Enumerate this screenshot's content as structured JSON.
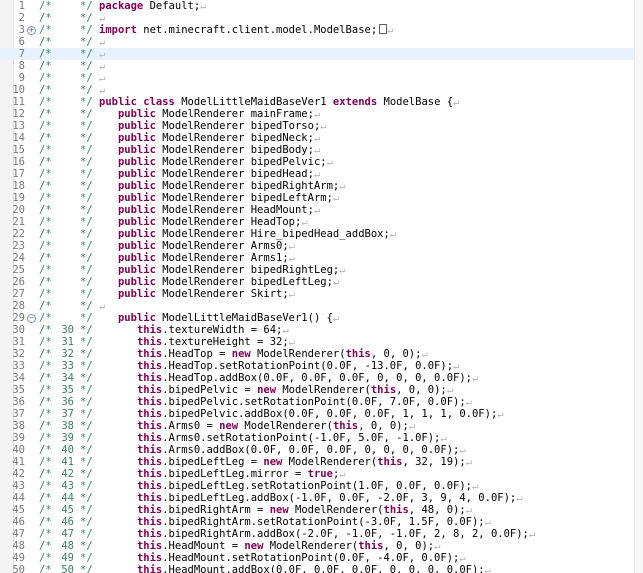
{
  "editor": {
    "comment_marker": "/*",
    "comment_end": "*/",
    "eol_marker": "↵",
    "lines": [
      {
        "n": "1",
        "code": "package Default;"
      },
      {
        "n": "2",
        "code": ""
      },
      {
        "n": "3",
        "code": "import net.minecraft.client.model.ModelBase;",
        "fold": "+",
        "box": true
      },
      {
        "n": "6",
        "code": ""
      },
      {
        "n": "7",
        "code": "",
        "current": true
      },
      {
        "n": "8",
        "code": ""
      },
      {
        "n": "9",
        "code": ""
      },
      {
        "n": "10",
        "code": ""
      },
      {
        "n": "11",
        "code": "public class ModelLittleMaidBaseVer1 extends ModelBase {"
      },
      {
        "n": "12",
        "code": "   public ModelRenderer mainFrame;"
      },
      {
        "n": "13",
        "code": "   public ModelRenderer bipedTorso;"
      },
      {
        "n": "14",
        "code": "   public ModelRenderer bipedNeck;"
      },
      {
        "n": "15",
        "code": "   public ModelRenderer bipedBody;"
      },
      {
        "n": "16",
        "code": "   public ModelRenderer bipedPelvic;"
      },
      {
        "n": "17",
        "code": "   public ModelRenderer bipedHead;"
      },
      {
        "n": "18",
        "code": "   public ModelRenderer bipedRightArm;"
      },
      {
        "n": "19",
        "code": "   public ModelRenderer bipedLeftArm;"
      },
      {
        "n": "20",
        "code": "   public ModelRenderer HeadMount;"
      },
      {
        "n": "21",
        "code": "   public ModelRenderer HeadTop;"
      },
      {
        "n": "22",
        "code": "   public ModelRenderer Hire_bipedHead_addBox;"
      },
      {
        "n": "23",
        "code": "   public ModelRenderer Arms0;"
      },
      {
        "n": "24",
        "code": "   public ModelRenderer Arms1;"
      },
      {
        "n": "25",
        "code": "   public ModelRenderer bipedRightLeg;"
      },
      {
        "n": "26",
        "code": "   public ModelRenderer bipedLeftLeg;"
      },
      {
        "n": "27",
        "code": "   public ModelRenderer Skirt;"
      },
      {
        "n": "28",
        "code": ""
      },
      {
        "n": "29",
        "code": "   public ModelLittleMaidBaseVer1() {",
        "fold": "−"
      },
      {
        "n": "30",
        "orig": "30",
        "code": "      this.textureWidth = 64;"
      },
      {
        "n": "31",
        "orig": "31",
        "code": "      this.textureHeight = 32;"
      },
      {
        "n": "32",
        "orig": "32",
        "code": "      this.HeadTop = new ModelRenderer(this, 0, 0);"
      },
      {
        "n": "33",
        "orig": "33",
        "code": "      this.HeadTop.setRotationPoint(0.0F, -13.0F, 0.0F);"
      },
      {
        "n": "34",
        "orig": "34",
        "code": "      this.HeadTop.addBox(0.0F, 0.0F, 0.0F, 0, 0, 0, 0.0F);"
      },
      {
        "n": "35",
        "orig": "35",
        "code": "      this.bipedPelvic = new ModelRenderer(this, 0, 0);"
      },
      {
        "n": "36",
        "orig": "36",
        "code": "      this.bipedPelvic.setRotationPoint(0.0F, 7.0F, 0.0F);"
      },
      {
        "n": "37",
        "orig": "37",
        "code": "      this.bipedPelvic.addBox(0.0F, 0.0F, 0.0F, 1, 1, 1, 0.0F);"
      },
      {
        "n": "38",
        "orig": "38",
        "code": "      this.Arms0 = new ModelRenderer(this, 0, 0);"
      },
      {
        "n": "39",
        "orig": "39",
        "code": "      this.Arms0.setRotationPoint(-1.0F, 5.0F, -1.0F);"
      },
      {
        "n": "40",
        "orig": "40",
        "code": "      this.Arms0.addBox(0.0F, 0.0F, 0.0F, 0, 0, 0, 0.0F);"
      },
      {
        "n": "41",
        "orig": "41",
        "code": "      this.bipedLeftLeg = new ModelRenderer(this, 32, 19);"
      },
      {
        "n": "42",
        "orig": "42",
        "code": "      this.bipedLeftLeg.mirror = true;"
      },
      {
        "n": "43",
        "orig": "43",
        "code": "      this.bipedLeftLeg.setRotationPoint(1.0F, 0.0F, 0.0F);"
      },
      {
        "n": "44",
        "orig": "44",
        "code": "      this.bipedLeftLeg.addBox(-1.0F, 0.0F, -2.0F, 3, 9, 4, 0.0F);"
      },
      {
        "n": "45",
        "orig": "45",
        "code": "      this.bipedRightArm = new ModelRenderer(this, 48, 0);"
      },
      {
        "n": "46",
        "orig": "46",
        "code": "      this.bipedRightArm.setRotationPoint(-3.0F, 1.5F, 0.0F);"
      },
      {
        "n": "47",
        "orig": "47",
        "code": "      this.bipedRightArm.addBox(-2.0F, -1.0F, -1.0F, 2, 8, 2, 0.0F);"
      },
      {
        "n": "48",
        "orig": "48",
        "code": "      this.HeadMount = new ModelRenderer(this, 0, 0);"
      },
      {
        "n": "49",
        "orig": "49",
        "code": "      this.HeadMount.setRotationPoint(0.0F, -4.0F, 0.0F);"
      },
      {
        "n": "50",
        "orig": "50",
        "code": "      this.HeadMount.addBox(0.0F, 0.0F, 0.0F, 0, 0, 0, 0.0F);"
      }
    ]
  }
}
